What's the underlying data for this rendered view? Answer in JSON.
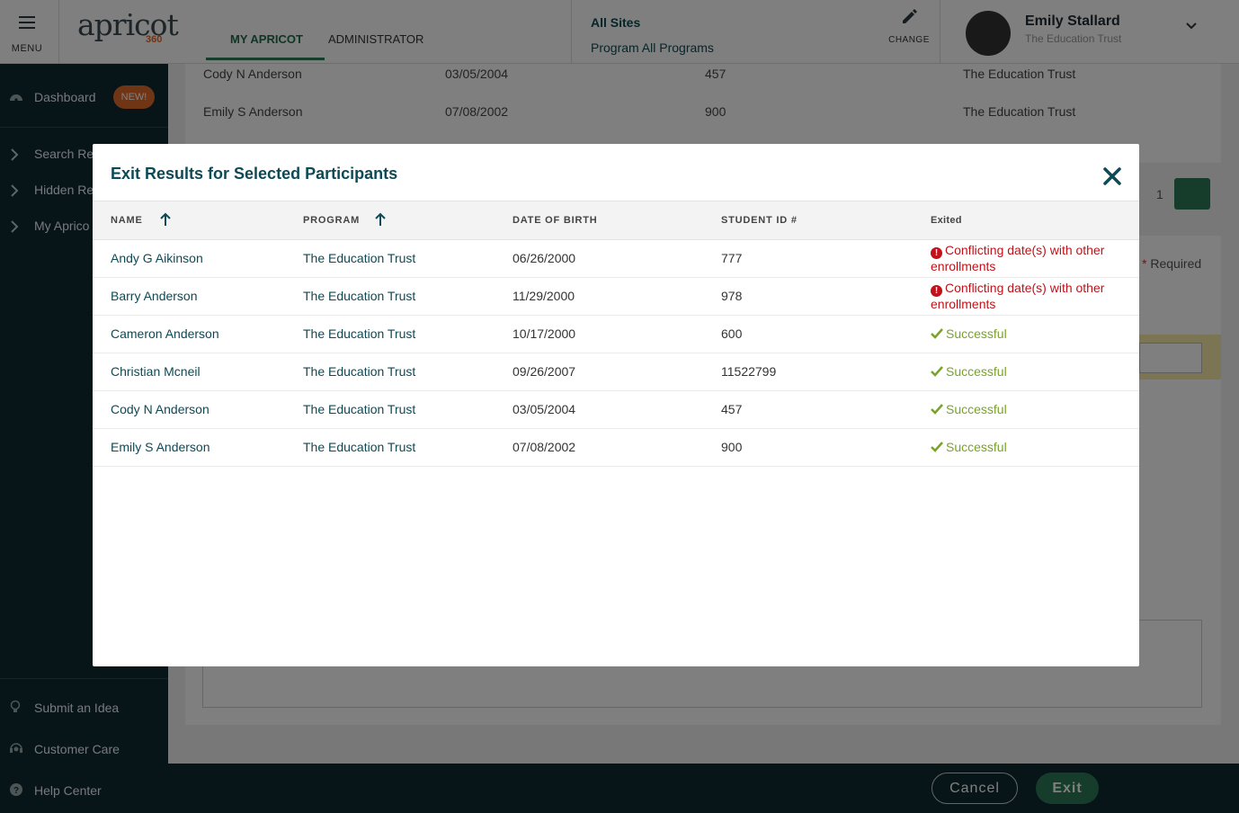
{
  "header": {
    "menu_label": "MENU",
    "logo_text": "apricot",
    "logo_sub": "360",
    "tabs": [
      {
        "label": "MY APRICOT"
      },
      {
        "label": "ADMINISTRATOR"
      }
    ],
    "sites_label": "All Sites",
    "program_label": "Program All Programs",
    "change_label": "CHANGE",
    "user_name": "Emily Stallard",
    "user_org": "The Education Trust"
  },
  "sidebar": {
    "dashboard_label": "Dashboard",
    "new_badge": "NEW!",
    "items": [
      {
        "label": "Search Re"
      },
      {
        "label": "Hidden Re"
      },
      {
        "label": "My Aprico"
      }
    ],
    "footer_items": [
      {
        "label": "Submit an Idea"
      },
      {
        "label": "Customer Care"
      },
      {
        "label": "Help Center"
      }
    ]
  },
  "background": {
    "rows": [
      {
        "name": "Cody N Anderson",
        "dob": "03/05/2004",
        "id": "457",
        "program": "The Education Trust"
      },
      {
        "name": "Emily S Anderson",
        "dob": "07/08/2002",
        "id": "900",
        "program": "The Education Trust"
      }
    ],
    "page_number": "1",
    "required_label": "Required",
    "required_marker": "*"
  },
  "footer": {
    "cancel_label": "Cancel",
    "exit_label": "Exit"
  },
  "modal": {
    "title": "Exit Results for Selected Participants",
    "columns": {
      "name": "NAME",
      "program": "PROGRAM",
      "dob": "DATE OF BIRTH",
      "student_id": "STUDENT ID #",
      "exited": "Exited"
    },
    "rows": [
      {
        "name": "Andy G Aikinson",
        "program": "The Education Trust",
        "dob": "06/26/2000",
        "student_id": "777",
        "status": "Conflicting date(s) with other enrollments",
        "status_type": "error"
      },
      {
        "name": "Barry Anderson",
        "program": "The Education Trust",
        "dob": "11/29/2000",
        "student_id": "978",
        "status": "Conflicting date(s) with other enrollments",
        "status_type": "error"
      },
      {
        "name": "Cameron Anderson",
        "program": "The Education Trust",
        "dob": "10/17/2000",
        "student_id": "600",
        "status": "Successful",
        "status_type": "success"
      },
      {
        "name": "Christian Mcneil",
        "program": "The Education Trust",
        "dob": "09/26/2007",
        "student_id": "11522799",
        "status": "Successful",
        "status_type": "success"
      },
      {
        "name": "Cody N Anderson",
        "program": "The Education Trust",
        "dob": "03/05/2004",
        "student_id": "457",
        "status": "Successful",
        "status_type": "success"
      },
      {
        "name": "Emily S Anderson",
        "program": "The Education Trust",
        "dob": "07/08/2002",
        "student_id": "900",
        "status": "Successful",
        "status_type": "success"
      }
    ]
  },
  "colors": {
    "brand_dark": "#0f2a33",
    "brand_green": "#2c7a56",
    "title_teal": "#0d4a55",
    "error_red": "#c0121a",
    "success_green": "#7aa22a",
    "badge_orange": "#e06a2a"
  },
  "icons": {
    "menu": "hamburger-icon",
    "change": "pencil-icon",
    "user_chevron": "chevron-down-icon",
    "close": "close-icon",
    "sort": "arrow-up-icon",
    "error": "exclamation-circle-icon",
    "success": "check-icon"
  }
}
